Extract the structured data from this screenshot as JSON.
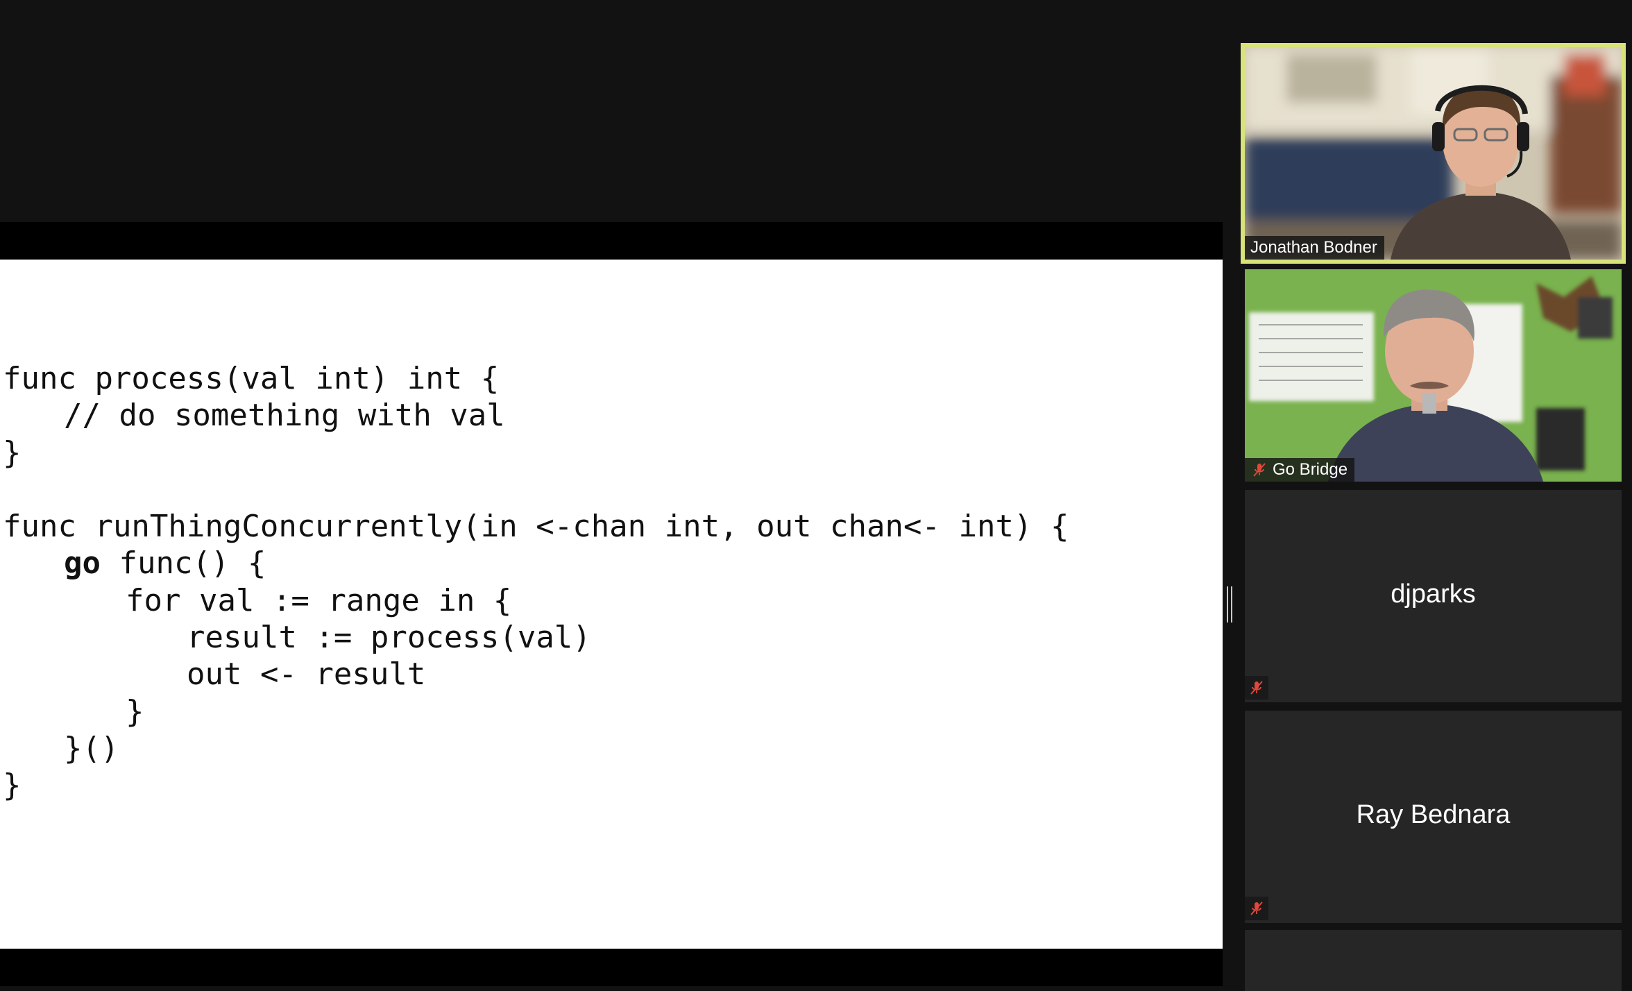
{
  "slide": {
    "code_lines": [
      "func process(val int) int {",
      "// do something with val",
      "}",
      "",
      "func runThingConcurrently(in <-chan int, out chan<- int) {",
      "go",
      " func() {",
      "for val := range in {",
      "result := process(val)",
      "out <- result",
      "}",
      "}()",
      "}"
    ]
  },
  "participants": [
    {
      "name": "Jonathan Bodner",
      "video": true,
      "active_speaker": true,
      "muted": false
    },
    {
      "name": "Go Bridge",
      "video": true,
      "active_speaker": false,
      "muted": true
    },
    {
      "name": "djparks",
      "video": false,
      "active_speaker": false,
      "muted": true
    },
    {
      "name": "Ray Bednara",
      "video": false,
      "active_speaker": false,
      "muted": true
    }
  ],
  "colors": {
    "background": "#121212",
    "tile_background": "#262626",
    "active_speaker_border": "#d8e47a",
    "mute_icon": "#e0483c"
  },
  "icons": {
    "muted": "microphone-muted-icon",
    "splitter": "resize-handle-icon"
  }
}
